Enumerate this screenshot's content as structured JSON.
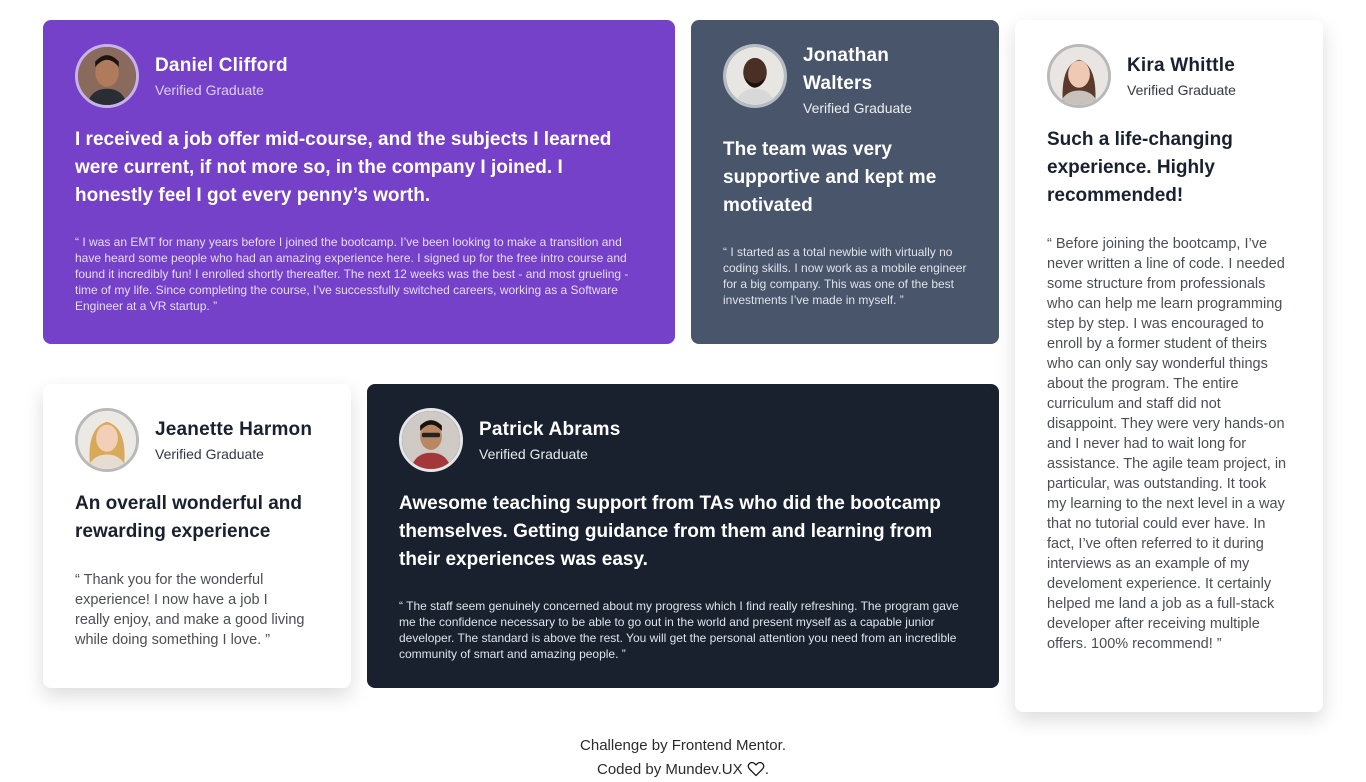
{
  "testimonials": [
    {
      "name": "Daniel Clifford",
      "role": "Verified Graduate",
      "headline": "I received a job offer mid-course, and the subjects I learned were current, if not more so, in the company I joined. I honestly feel I got every penny’s worth.",
      "quote": "“ I was an EMT for many years before I joined the bootcamp. I’ve been looking to make a transition and have heard some people who had an amazing experience here. I signed up for the free intro course and found it incredibly fun! I enrolled shortly thereafter. The next 12 weeks was the best - and most grueling - time of my life. Since completing the course, I’ve successfully switched careers, working as a Software Engineer at a VR startup. ”",
      "color": "#7541c8"
    },
    {
      "name": "Jonathan Walters",
      "role": "Verified Graduate",
      "headline": "The team was very supportive and kept me motivated",
      "quote": "“ I started as a total newbie with virtually no coding skills. I now work as a mobile engineer for a big company. This was one of the best investments I’ve made in myself. ”",
      "color": "#48556a"
    },
    {
      "name": "Kira Whittle",
      "role": "Verified Graduate",
      "headline": "Such a life-changing experience. Highly recommended!",
      "quote": "“ Before joining the bootcamp, I’ve never written a line of code. I needed some structure from professionals who can help me learn programming step by step. I was encouraged to enroll by a former student of theirs who can only say wonderful things about the program. The entire curriculum and staff did not disappoint. They were very hands-on and I never had to wait long for assistance. The agile team project, in particular, was outstanding. It took my learning to the next level in a way that no tutorial could ever have. In fact, I’ve often referred to it during interviews as an example of my develoment experience. It certainly helped me land a job as a full-stack developer after receiving multiple offers. 100% recommend! ”",
      "color": "#ffffff"
    },
    {
      "name": "Jeanette Harmon",
      "role": "Verified Graduate",
      "headline": "An overall wonderful and rewarding experience",
      "quote": "“ Thank you for the wonderful experience! I now have a job I really enjoy, and make a good living while doing something I love. ”",
      "color": "#ffffff"
    },
    {
      "name": "Patrick Abrams",
      "role": "Verified Graduate",
      "headline": "Awesome teaching support from TAs who did the bootcamp themselves. Getting guidance from them and learning from their experiences was easy.",
      "quote": "“ The staff seem genuinely concerned about my progress which I find really refreshing. The program gave me the confidence necessary to be able to go out in the world and present myself as a capable junior developer. The standard is above the rest. You will get the personal attention you need from an incredible community of smart and amazing people. ”",
      "color": "#19212e"
    }
  ],
  "footer": {
    "line1_prefix": "Challenge by ",
    "line1_link": "Frontend Mentor",
    "line1_suffix": ".",
    "line2_prefix": "Coded by ",
    "line2_link": "Mundev.UX",
    "line2_suffix": ".",
    "heart_icon": "heart-outline-icon"
  }
}
